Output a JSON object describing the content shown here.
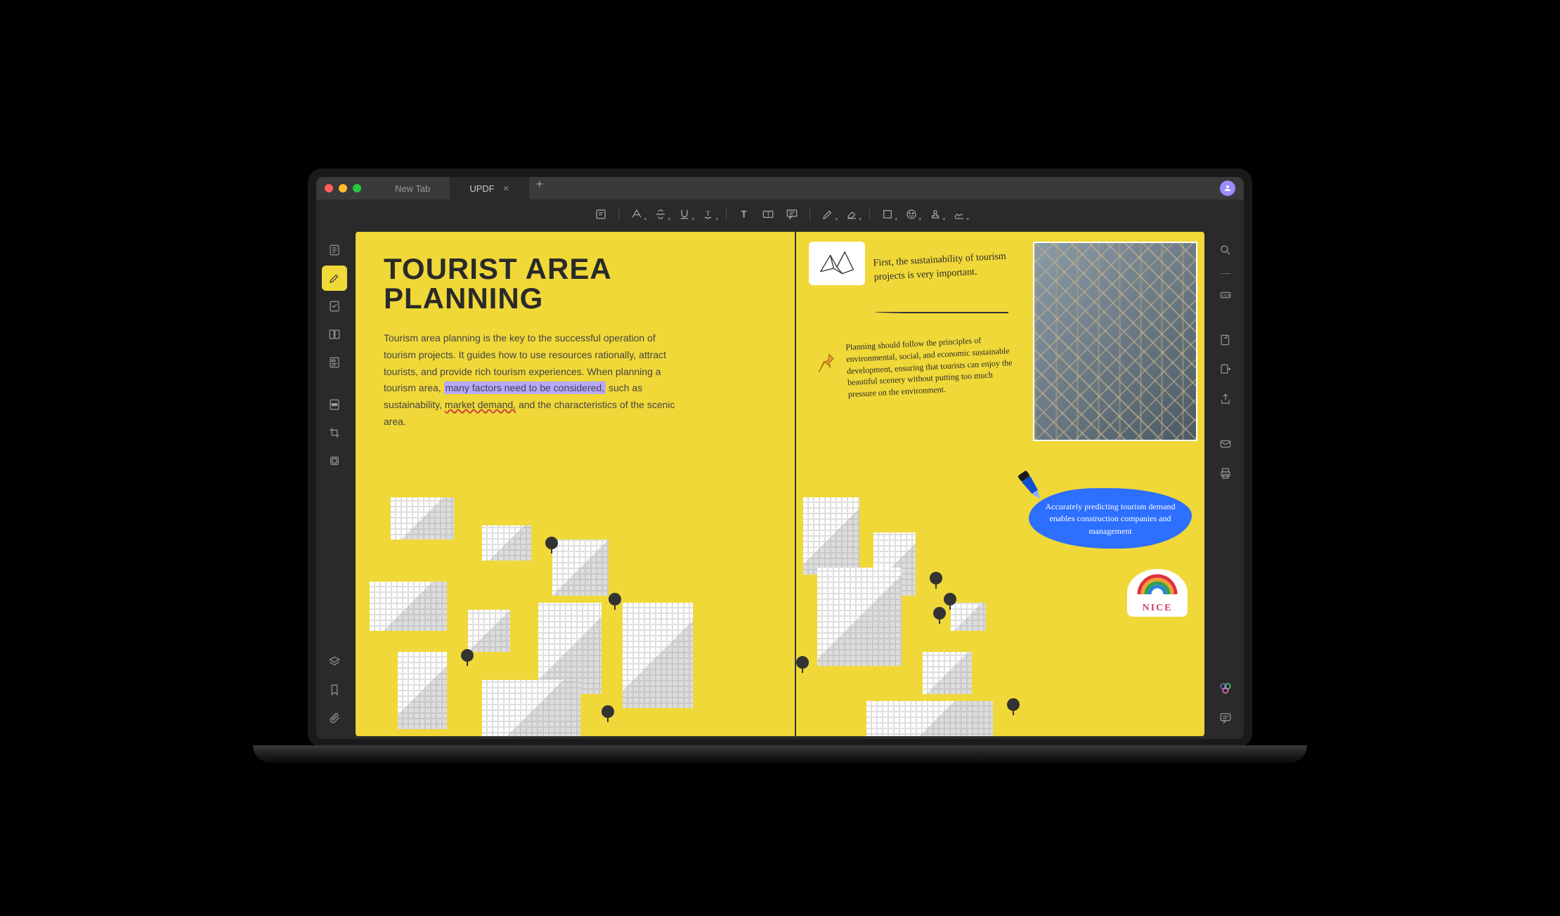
{
  "tabs": {
    "inactive": "New Tab",
    "active": "UPDF"
  },
  "document": {
    "title": "TOURIST AREA PLANNING",
    "para_start": "Tourism area planning is the key to the successful operation of tourism projects.  It guides how to use resources rationally, attract tourists, and provide rich tourism experiences. When planning a tourism area, ",
    "highlighted": "many factors need to be considered,",
    "after_hl": " such as sustainability, ",
    "squiggled": "market demand,",
    "para_end": " and the characteristics of the scenic area."
  },
  "notes": {
    "hw1": "First, the sustainability of tourism projects is very important.",
    "hw2": "Planning should follow the principles of environmental, social, and economic sustainable development, ensuring that tourists can enjoy the beautiful scenery without putting too much pressure on the environment.",
    "marker": "Accurately predicting tourism demand enables construction companies and management",
    "sticker": "NICE"
  },
  "sidebar": {
    "reader": "reader-icon",
    "comment_active": "comment-icon",
    "edit": "edit-icon",
    "organize": "organize-icon",
    "tools": "tools-icon",
    "protect": "protect-icon",
    "form": "form-icon",
    "crop": "crop-icon"
  },
  "rightbar": {
    "search": "search-icon"
  }
}
